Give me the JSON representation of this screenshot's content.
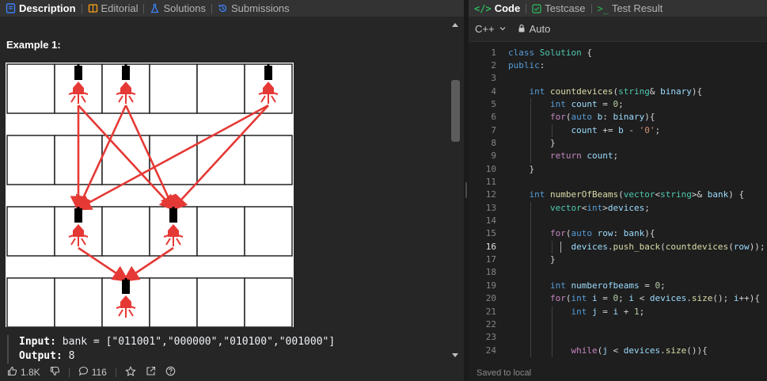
{
  "left_panel": {
    "tabs": [
      {
        "label": "Description",
        "icon": "description-icon",
        "active": true
      },
      {
        "label": "Editorial",
        "icon": "book-icon",
        "active": false
      },
      {
        "label": "Solutions",
        "icon": "flask-icon",
        "active": false
      },
      {
        "label": "Submissions",
        "icon": "history-icon",
        "active": false
      }
    ],
    "example_title": "Example 1:",
    "io": {
      "input_label": "Input:",
      "input_value": " bank = [\"011001\",\"000000\",\"010100\",\"001000\"]",
      "output_label": "Output:",
      "output_value": " 8"
    },
    "footer": {
      "likes": "1.8K",
      "comments": "116"
    }
  },
  "figure": {
    "rows": [
      "011001",
      "000000",
      "010100",
      "001000"
    ],
    "device_color": "#000000",
    "beam_color": "#e53935"
  },
  "right_panel": {
    "tabs": [
      {
        "label": "Code",
        "icon": "code-icon",
        "active": true
      },
      {
        "label": "Testcase",
        "icon": "checkbox-icon",
        "active": false
      },
      {
        "label": "Test Result",
        "icon": "terminal-icon",
        "active": false
      }
    ],
    "toolbar": {
      "language": "C++",
      "mode": "Auto"
    },
    "status": "Saved to local",
    "current_line": 16,
    "code_lines": [
      "class Solution {",
      "public:",
      "",
      "    int countdevices(string& binary){",
      "        int count = 0;",
      "        for(auto b: binary){",
      "            count += b - '0';",
      "        }",
      "        return count;",
      "    }",
      "",
      "    int numberOfBeams(vector<string>& bank) {",
      "        vector<int>devices;",
      "",
      "        for(auto row: bank){",
      "            devices.push_back(countdevices(row));",
      "        }",
      "",
      "        int numberofbeams = 0;",
      "        for(int i = 0; i < devices.size(); i++){",
      "            int j = i + 1;",
      "",
      "",
      "            while(j < devices.size()){"
    ]
  },
  "colors": {
    "accent": "#ffa116",
    "code_green": "#2cbb5d"
  }
}
